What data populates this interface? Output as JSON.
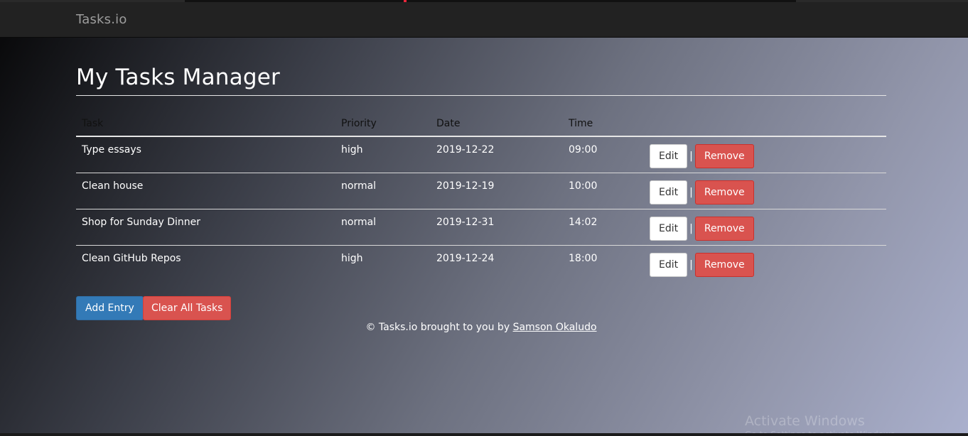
{
  "navbar": {
    "brand": "Tasks.io"
  },
  "page": {
    "title": "My Tasks Manager"
  },
  "table": {
    "headers": [
      "Task",
      "Priority",
      "Date",
      "Time"
    ],
    "rows": [
      {
        "task": "Type essays",
        "priority": "high",
        "date": "2019-12-22",
        "time": "09:00"
      },
      {
        "task": "Clean house",
        "priority": "normal",
        "date": "2019-12-19",
        "time": "10:00"
      },
      {
        "task": "Shop for Sunday Dinner",
        "priority": "normal",
        "date": "2019-12-31",
        "time": "14:02"
      },
      {
        "task": "Clean GitHub Repos",
        "priority": "high",
        "date": "2019-12-24",
        "time": "18:00"
      }
    ],
    "edit_label": "Edit",
    "separator": "|",
    "remove_label": "Remove"
  },
  "actions": {
    "add_label": "Add Entry",
    "clear_label": "Clear All Tasks"
  },
  "footer": {
    "prefix": "© Tasks.io brought to you by ",
    "author_link": "Samson Okaludo"
  },
  "watermark": {
    "title": "Activate Windows",
    "subtitle": "Go to Settings to activate Windows."
  },
  "colors": {
    "navbar_bg": "#222222",
    "primary": "#337ab7",
    "danger": "#d9534f"
  }
}
